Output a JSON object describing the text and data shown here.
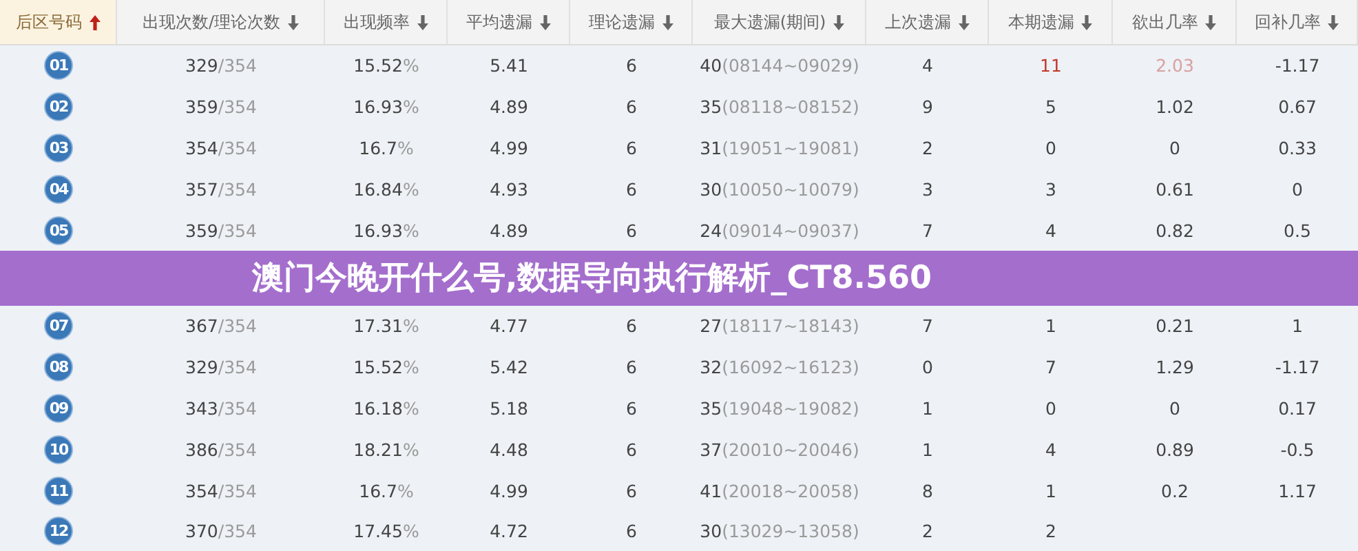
{
  "columns": [
    {
      "label": "后区号码",
      "sorted": true
    },
    {
      "label": "出现次数/理论次数",
      "sorted": false
    },
    {
      "label": "出现频率",
      "sorted": false
    },
    {
      "label": "平均遗漏",
      "sorted": false
    },
    {
      "label": "理论遗漏",
      "sorted": false
    },
    {
      "label": "最大遗漏(期间)",
      "sorted": false
    },
    {
      "label": "上次遗漏",
      "sorted": false
    },
    {
      "label": "本期遗漏",
      "sorted": false
    },
    {
      "label": "欲出几率",
      "sorted": false
    },
    {
      "label": "回补几率",
      "sorted": false
    }
  ],
  "rows": [
    {
      "number": "01",
      "count": "329",
      "theory": "/354",
      "rate": "15.52",
      "rate_unit": "%",
      "avg": "5.41",
      "theory_miss": "6",
      "max": "40",
      "max_period": "(08144~09029)",
      "last": "4",
      "current": "11",
      "chance": "2.03",
      "rebound": "-1.17",
      "hot": true
    },
    {
      "number": "02",
      "count": "359",
      "theory": "/354",
      "rate": "16.93",
      "rate_unit": "%",
      "avg": "4.89",
      "theory_miss": "6",
      "max": "35",
      "max_period": "(08118~08152)",
      "last": "9",
      "current": "5",
      "chance": "1.02",
      "rebound": "0.67",
      "hot": false
    },
    {
      "number": "03",
      "count": "354",
      "theory": "/354",
      "rate": "16.7",
      "rate_unit": "%",
      "avg": "4.99",
      "theory_miss": "6",
      "max": "31",
      "max_period": "(19051~19081)",
      "last": "2",
      "current": "0",
      "chance": "0",
      "rebound": "0.33",
      "hot": false
    },
    {
      "number": "04",
      "count": "357",
      "theory": "/354",
      "rate": "16.84",
      "rate_unit": "%",
      "avg": "4.93",
      "theory_miss": "6",
      "max": "30",
      "max_period": "(10050~10079)",
      "last": "3",
      "current": "3",
      "chance": "0.61",
      "rebound": "0",
      "hot": false
    },
    {
      "number": "05",
      "count": "359",
      "theory": "/354",
      "rate": "16.93",
      "rate_unit": "%",
      "avg": "4.89",
      "theory_miss": "6",
      "max": "24",
      "max_period": "(09014~09037)",
      "last": "7",
      "current": "4",
      "chance": "0.82",
      "rebound": "0.5",
      "hot": false
    },
    {
      "number": "07",
      "count": "367",
      "theory": "/354",
      "rate": "17.31",
      "rate_unit": "%",
      "avg": "4.77",
      "theory_miss": "6",
      "max": "27",
      "max_period": "(18117~18143)",
      "last": "7",
      "current": "1",
      "chance": "0.21",
      "rebound": "1",
      "hot": false
    },
    {
      "number": "08",
      "count": "329",
      "theory": "/354",
      "rate": "15.52",
      "rate_unit": "%",
      "avg": "5.42",
      "theory_miss": "6",
      "max": "32",
      "max_period": "(16092~16123)",
      "last": "0",
      "current": "7",
      "chance": "1.29",
      "rebound": "-1.17",
      "hot": false
    },
    {
      "number": "09",
      "count": "343",
      "theory": "/354",
      "rate": "16.18",
      "rate_unit": "%",
      "avg": "5.18",
      "theory_miss": "6",
      "max": "35",
      "max_period": "(19048~19082)",
      "last": "1",
      "current": "0",
      "chance": "0",
      "rebound": "0.17",
      "hot": false
    },
    {
      "number": "10",
      "count": "386",
      "theory": "/354",
      "rate": "18.21",
      "rate_unit": "%",
      "avg": "4.48",
      "theory_miss": "6",
      "max": "37",
      "max_period": "(20010~20046)",
      "last": "1",
      "current": "4",
      "chance": "0.89",
      "rebound": "-0.5",
      "hot": false
    },
    {
      "number": "11",
      "count": "354",
      "theory": "/354",
      "rate": "16.7",
      "rate_unit": "%",
      "avg": "4.99",
      "theory_miss": "6",
      "max": "41",
      "max_period": "(20018~20058)",
      "last": "8",
      "current": "1",
      "chance": "0.2",
      "rebound": "1.17",
      "hot": false
    },
    {
      "number": "12",
      "count": "370",
      "theory": "/354",
      "rate": "17.45",
      "rate_unit": "%",
      "avg": "4.72",
      "theory_miss": "6",
      "max": "30",
      "max_period": "(13029~13058)",
      "last": "2",
      "current": "2",
      "hot": false
    }
  ],
  "banner": {
    "title": "澳门今晚开什么号,数据导向执行解析_CT8.560"
  }
}
